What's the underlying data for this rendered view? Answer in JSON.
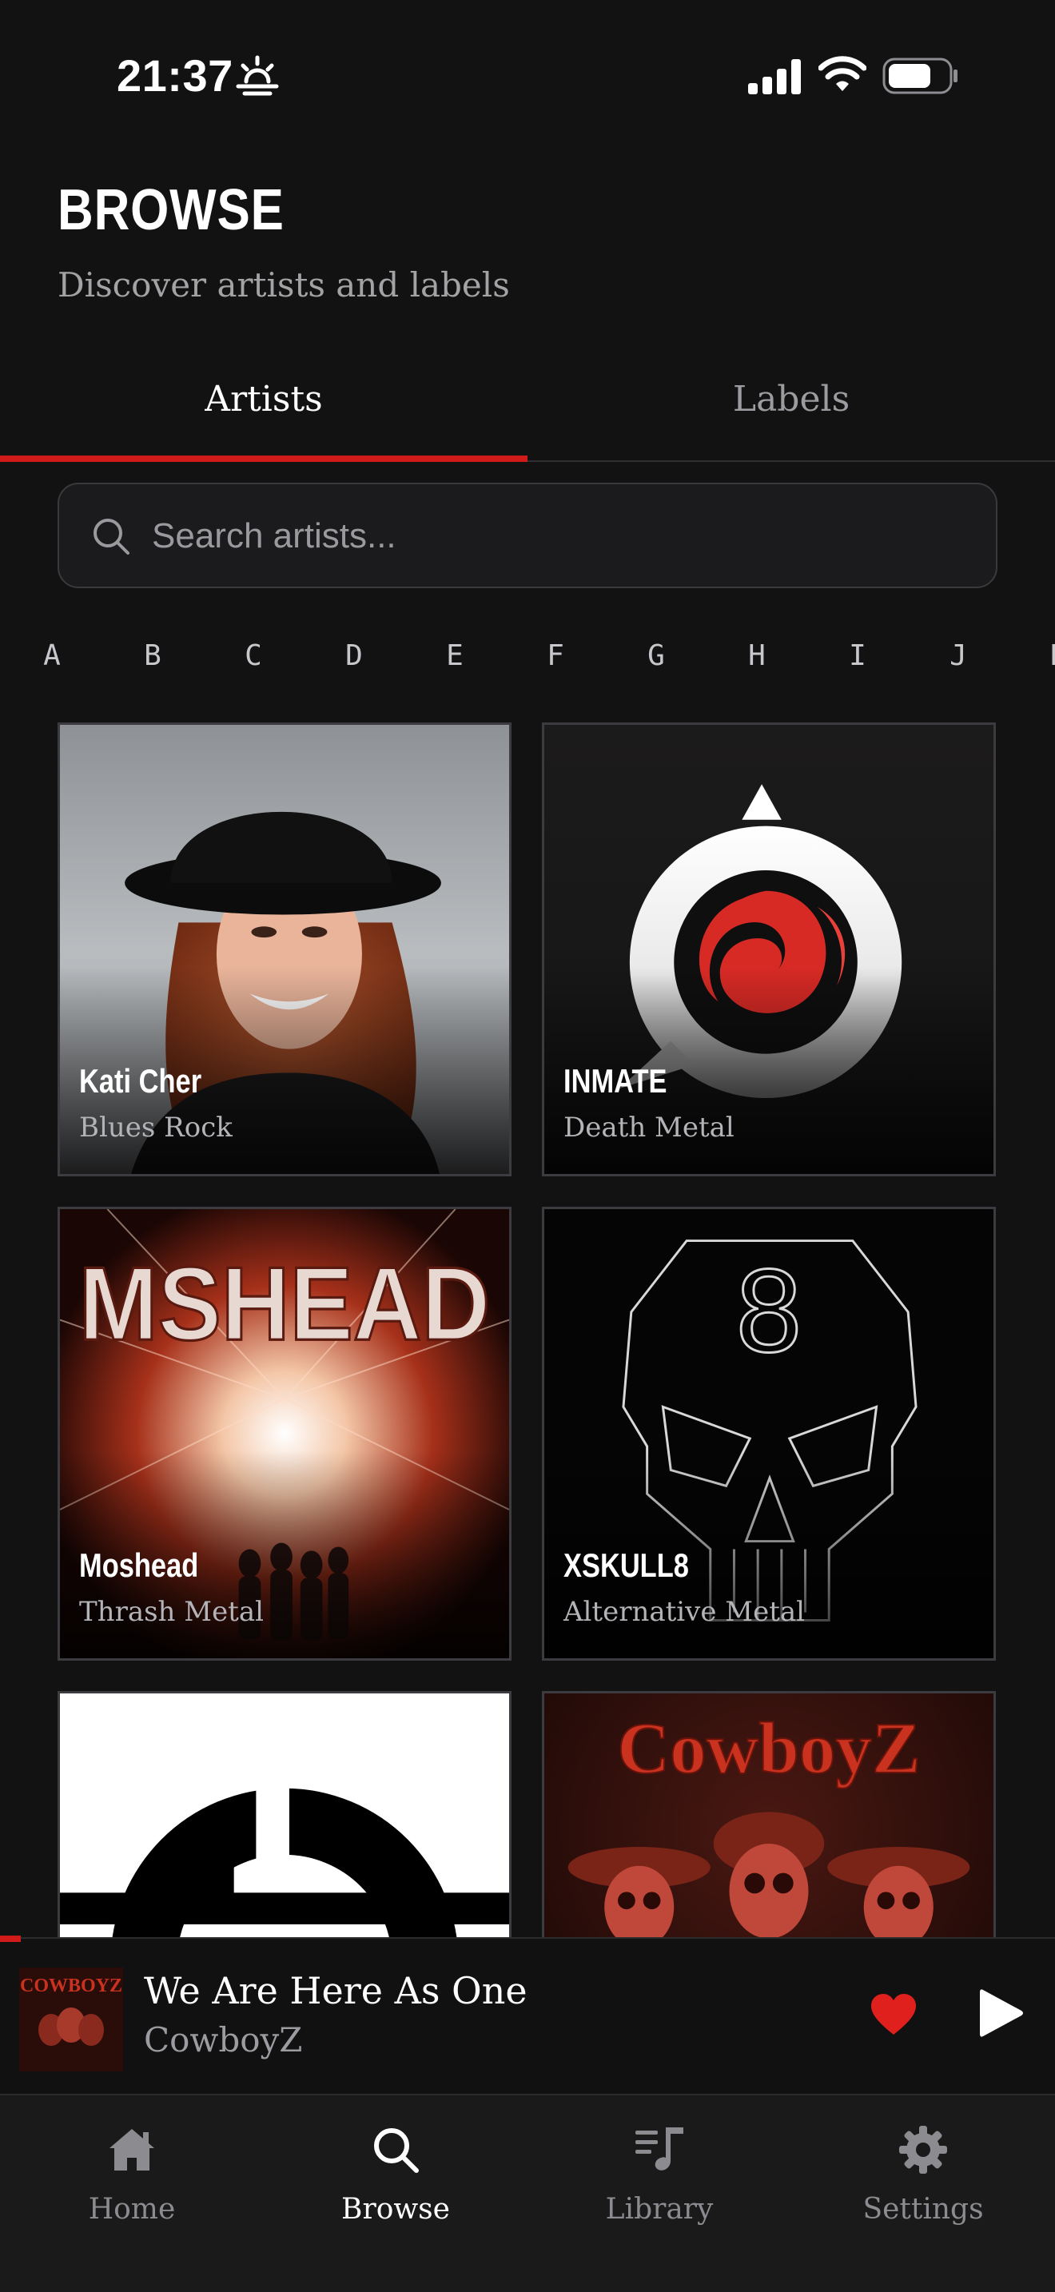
{
  "status_bar": {
    "time": "21:37"
  },
  "header": {
    "title": "BROWSE",
    "subtitle": "Discover artists and labels"
  },
  "tabs": [
    {
      "label": "Artists",
      "active": true
    },
    {
      "label": "Labels",
      "active": false
    }
  ],
  "search": {
    "placeholder": "Search artists...",
    "value": ""
  },
  "alphabet": [
    "A",
    "B",
    "C",
    "D",
    "E",
    "F",
    "G",
    "H",
    "I",
    "J",
    "K"
  ],
  "artists": [
    {
      "name": "Kati Cher",
      "genre": "Blues Rock"
    },
    {
      "name": "INMATE",
      "genre": "Death Metal"
    },
    {
      "name": "Moshead",
      "genre": "Thrash Metal",
      "art_text": "MSHEAD"
    },
    {
      "name": "XSKULL8",
      "genre": "Alternative Metal",
      "art_text": "8"
    },
    {
      "name": "",
      "genre": ""
    },
    {
      "name": "",
      "genre": "",
      "art_text": "CowboyZ"
    }
  ],
  "now_playing": {
    "title": "We Are Here As One",
    "artist": "CowboyZ",
    "art_text": "COWBOYZ",
    "progress": 0.02,
    "liked": true
  },
  "bottom_nav": [
    {
      "label": "Home",
      "icon": "home-icon",
      "active": false
    },
    {
      "label": "Browse",
      "icon": "search-icon",
      "active": true
    },
    {
      "label": "Library",
      "icon": "music-note-icon",
      "active": false
    },
    {
      "label": "Settings",
      "icon": "gear-icon",
      "active": false
    }
  ],
  "colors": {
    "background": "#121213",
    "accent": "#d11a1a",
    "text_secondary": "#9c9ca0"
  }
}
